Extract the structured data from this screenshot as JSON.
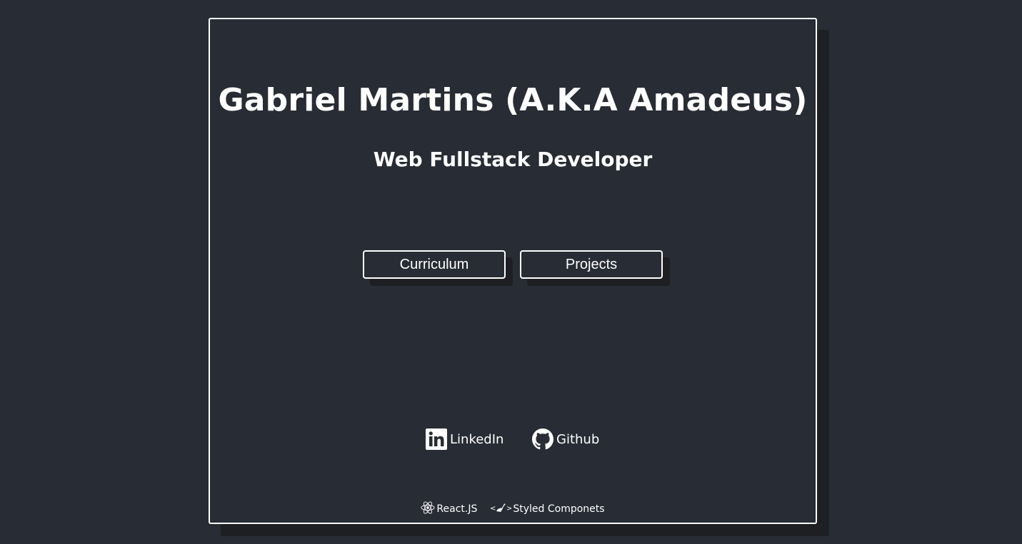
{
  "header": {
    "title": "Gabriel Martins (A.K.A Amadeus)",
    "subtitle": "Web Fullstack Developer"
  },
  "nav": {
    "buttons": [
      {
        "label": "Curriculum"
      },
      {
        "label": "Projects"
      }
    ]
  },
  "social": {
    "links": [
      {
        "label": "LinkedIn",
        "icon": "linkedin-icon"
      },
      {
        "label": "Github",
        "icon": "github-icon"
      }
    ]
  },
  "footer": {
    "items": [
      {
        "label": "React.JS",
        "icon": "react-icon"
      },
      {
        "label": "Styled Componets",
        "icon": "styled-components-icon"
      }
    ]
  },
  "colors": {
    "background": "#282c34",
    "shadow": "#1e1f22",
    "border": "#ffffff",
    "text": "#ffffff"
  }
}
